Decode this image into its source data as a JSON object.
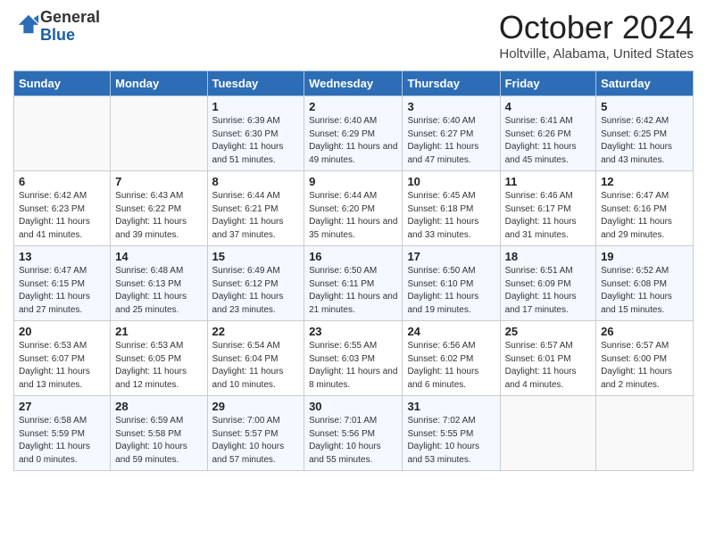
{
  "header": {
    "logo_general": "General",
    "logo_blue": "Blue",
    "month_title": "October 2024",
    "location": "Holtville, Alabama, United States"
  },
  "days_of_week": [
    "Sunday",
    "Monday",
    "Tuesday",
    "Wednesday",
    "Thursday",
    "Friday",
    "Saturday"
  ],
  "weeks": [
    [
      {
        "day": "",
        "sunrise": "",
        "sunset": "",
        "daylight": ""
      },
      {
        "day": "",
        "sunrise": "",
        "sunset": "",
        "daylight": ""
      },
      {
        "day": "1",
        "sunrise": "Sunrise: 6:39 AM",
        "sunset": "Sunset: 6:30 PM",
        "daylight": "Daylight: 11 hours and 51 minutes."
      },
      {
        "day": "2",
        "sunrise": "Sunrise: 6:40 AM",
        "sunset": "Sunset: 6:29 PM",
        "daylight": "Daylight: 11 hours and 49 minutes."
      },
      {
        "day": "3",
        "sunrise": "Sunrise: 6:40 AM",
        "sunset": "Sunset: 6:27 PM",
        "daylight": "Daylight: 11 hours and 47 minutes."
      },
      {
        "day": "4",
        "sunrise": "Sunrise: 6:41 AM",
        "sunset": "Sunset: 6:26 PM",
        "daylight": "Daylight: 11 hours and 45 minutes."
      },
      {
        "day": "5",
        "sunrise": "Sunrise: 6:42 AM",
        "sunset": "Sunset: 6:25 PM",
        "daylight": "Daylight: 11 hours and 43 minutes."
      }
    ],
    [
      {
        "day": "6",
        "sunrise": "Sunrise: 6:42 AM",
        "sunset": "Sunset: 6:23 PM",
        "daylight": "Daylight: 11 hours and 41 minutes."
      },
      {
        "day": "7",
        "sunrise": "Sunrise: 6:43 AM",
        "sunset": "Sunset: 6:22 PM",
        "daylight": "Daylight: 11 hours and 39 minutes."
      },
      {
        "day": "8",
        "sunrise": "Sunrise: 6:44 AM",
        "sunset": "Sunset: 6:21 PM",
        "daylight": "Daylight: 11 hours and 37 minutes."
      },
      {
        "day": "9",
        "sunrise": "Sunrise: 6:44 AM",
        "sunset": "Sunset: 6:20 PM",
        "daylight": "Daylight: 11 hours and 35 minutes."
      },
      {
        "day": "10",
        "sunrise": "Sunrise: 6:45 AM",
        "sunset": "Sunset: 6:18 PM",
        "daylight": "Daylight: 11 hours and 33 minutes."
      },
      {
        "day": "11",
        "sunrise": "Sunrise: 6:46 AM",
        "sunset": "Sunset: 6:17 PM",
        "daylight": "Daylight: 11 hours and 31 minutes."
      },
      {
        "day": "12",
        "sunrise": "Sunrise: 6:47 AM",
        "sunset": "Sunset: 6:16 PM",
        "daylight": "Daylight: 11 hours and 29 minutes."
      }
    ],
    [
      {
        "day": "13",
        "sunrise": "Sunrise: 6:47 AM",
        "sunset": "Sunset: 6:15 PM",
        "daylight": "Daylight: 11 hours and 27 minutes."
      },
      {
        "day": "14",
        "sunrise": "Sunrise: 6:48 AM",
        "sunset": "Sunset: 6:13 PM",
        "daylight": "Daylight: 11 hours and 25 minutes."
      },
      {
        "day": "15",
        "sunrise": "Sunrise: 6:49 AM",
        "sunset": "Sunset: 6:12 PM",
        "daylight": "Daylight: 11 hours and 23 minutes."
      },
      {
        "day": "16",
        "sunrise": "Sunrise: 6:50 AM",
        "sunset": "Sunset: 6:11 PM",
        "daylight": "Daylight: 11 hours and 21 minutes."
      },
      {
        "day": "17",
        "sunrise": "Sunrise: 6:50 AM",
        "sunset": "Sunset: 6:10 PM",
        "daylight": "Daylight: 11 hours and 19 minutes."
      },
      {
        "day": "18",
        "sunrise": "Sunrise: 6:51 AM",
        "sunset": "Sunset: 6:09 PM",
        "daylight": "Daylight: 11 hours and 17 minutes."
      },
      {
        "day": "19",
        "sunrise": "Sunrise: 6:52 AM",
        "sunset": "Sunset: 6:08 PM",
        "daylight": "Daylight: 11 hours and 15 minutes."
      }
    ],
    [
      {
        "day": "20",
        "sunrise": "Sunrise: 6:53 AM",
        "sunset": "Sunset: 6:07 PM",
        "daylight": "Daylight: 11 hours and 13 minutes."
      },
      {
        "day": "21",
        "sunrise": "Sunrise: 6:53 AM",
        "sunset": "Sunset: 6:05 PM",
        "daylight": "Daylight: 11 hours and 12 minutes."
      },
      {
        "day": "22",
        "sunrise": "Sunrise: 6:54 AM",
        "sunset": "Sunset: 6:04 PM",
        "daylight": "Daylight: 11 hours and 10 minutes."
      },
      {
        "day": "23",
        "sunrise": "Sunrise: 6:55 AM",
        "sunset": "Sunset: 6:03 PM",
        "daylight": "Daylight: 11 hours and 8 minutes."
      },
      {
        "day": "24",
        "sunrise": "Sunrise: 6:56 AM",
        "sunset": "Sunset: 6:02 PM",
        "daylight": "Daylight: 11 hours and 6 minutes."
      },
      {
        "day": "25",
        "sunrise": "Sunrise: 6:57 AM",
        "sunset": "Sunset: 6:01 PM",
        "daylight": "Daylight: 11 hours and 4 minutes."
      },
      {
        "day": "26",
        "sunrise": "Sunrise: 6:57 AM",
        "sunset": "Sunset: 6:00 PM",
        "daylight": "Daylight: 11 hours and 2 minutes."
      }
    ],
    [
      {
        "day": "27",
        "sunrise": "Sunrise: 6:58 AM",
        "sunset": "Sunset: 5:59 PM",
        "daylight": "Daylight: 11 hours and 0 minutes."
      },
      {
        "day": "28",
        "sunrise": "Sunrise: 6:59 AM",
        "sunset": "Sunset: 5:58 PM",
        "daylight": "Daylight: 10 hours and 59 minutes."
      },
      {
        "day": "29",
        "sunrise": "Sunrise: 7:00 AM",
        "sunset": "Sunset: 5:57 PM",
        "daylight": "Daylight: 10 hours and 57 minutes."
      },
      {
        "day": "30",
        "sunrise": "Sunrise: 7:01 AM",
        "sunset": "Sunset: 5:56 PM",
        "daylight": "Daylight: 10 hours and 55 minutes."
      },
      {
        "day": "31",
        "sunrise": "Sunrise: 7:02 AM",
        "sunset": "Sunset: 5:55 PM",
        "daylight": "Daylight: 10 hours and 53 minutes."
      },
      {
        "day": "",
        "sunrise": "",
        "sunset": "",
        "daylight": ""
      },
      {
        "day": "",
        "sunrise": "",
        "sunset": "",
        "daylight": ""
      }
    ]
  ]
}
